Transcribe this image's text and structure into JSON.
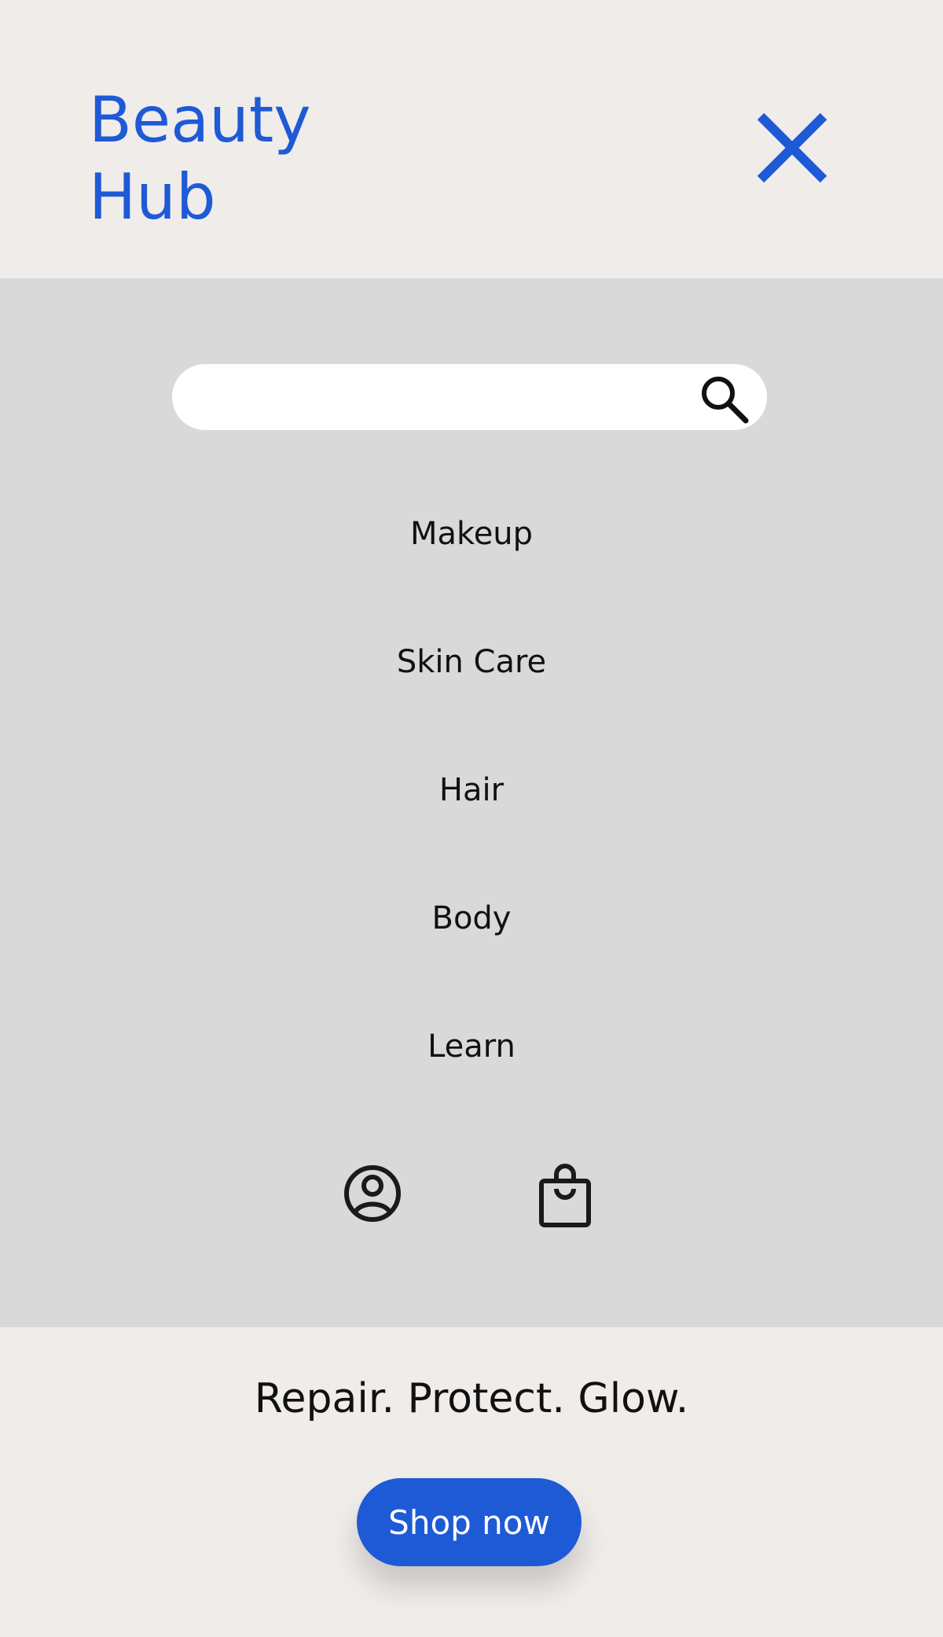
{
  "brand": {
    "line1": "Beauty",
    "line2": "Hub",
    "color": "#1f5ad6"
  },
  "header": {
    "close_icon": "close-icon"
  },
  "search": {
    "value": "",
    "placeholder": "",
    "icon": "search-icon"
  },
  "nav": {
    "items": [
      {
        "label": "Makeup"
      },
      {
        "label": "Skin Care"
      },
      {
        "label": "Hair"
      },
      {
        "label": "Body"
      },
      {
        "label": "Learn"
      }
    ]
  },
  "utility_icons": {
    "account": "account-icon",
    "bag": "shopping-bag-icon"
  },
  "hero": {
    "tagline": "Repair. Protect. Glow.",
    "cta_label": "Shop now"
  },
  "colors": {
    "accent": "#1f5ad6",
    "page_background": "#efecea",
    "menu_background": "#d9d9d9"
  }
}
